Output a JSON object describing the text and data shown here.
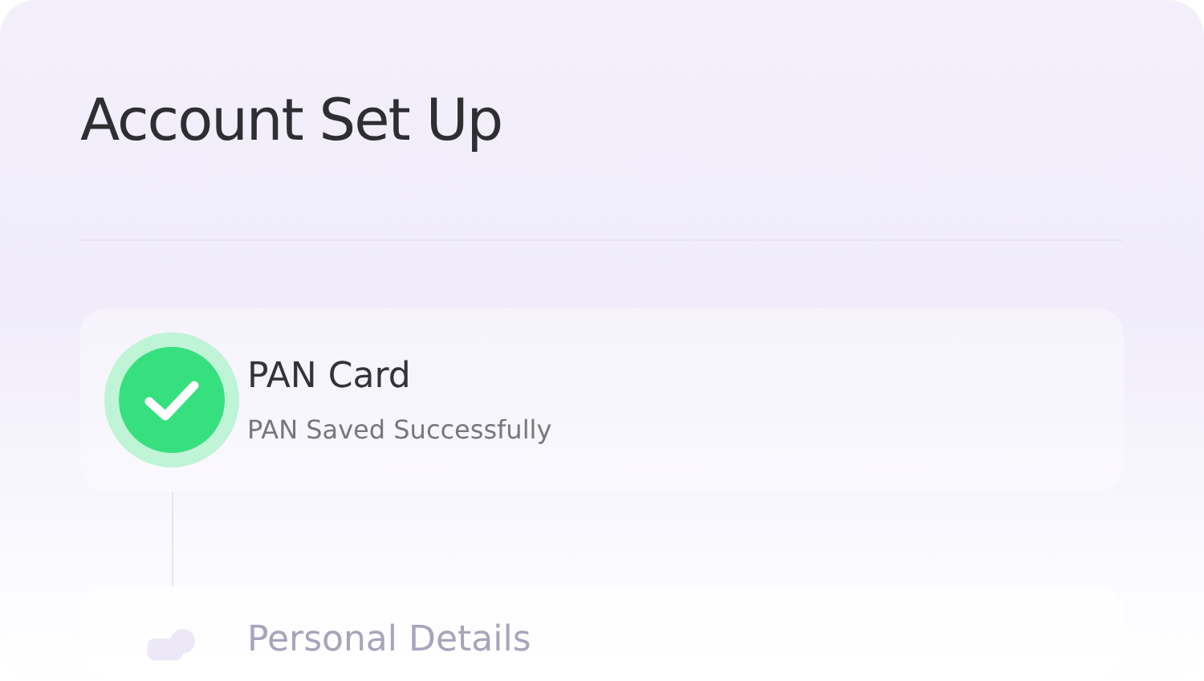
{
  "title": "Account Set Up",
  "steps": [
    {
      "kind": "done",
      "title": "PAN Card",
      "subtitle": "PAN Saved Successfully"
    },
    {
      "kind": "pending",
      "title": "Personal Details"
    }
  ]
}
